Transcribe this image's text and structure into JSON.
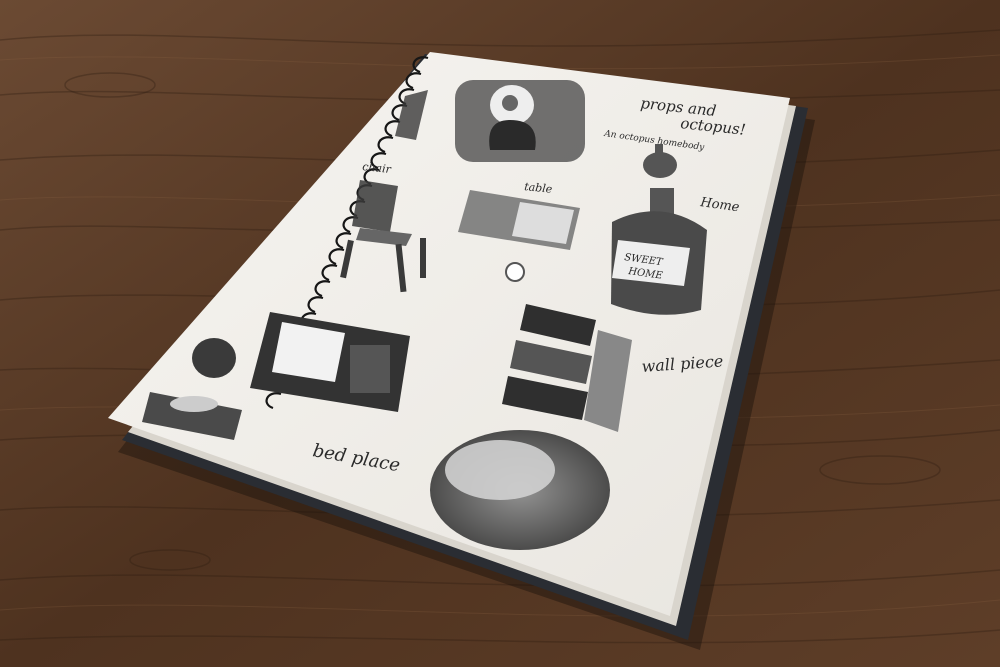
{
  "colors": {
    "table_wood": "#5a3b26",
    "table_wood_dark": "#3b2416",
    "page": "#f2f0ec",
    "cover": "#2a2d33",
    "ink": "#2a2a2a",
    "spiral": "#1a1a1a"
  },
  "sketchbook": {
    "title_line1": "props and",
    "title_line2": "octopus!",
    "subtitle": "An octopus homebody",
    "labels": {
      "chair": "chair",
      "table": "table",
      "home": "Home",
      "wallpiece": "wall piece",
      "bedplace": "bed place",
      "bottle_text_line1": "SWEET",
      "bottle_text_line2": "HOME"
    }
  }
}
